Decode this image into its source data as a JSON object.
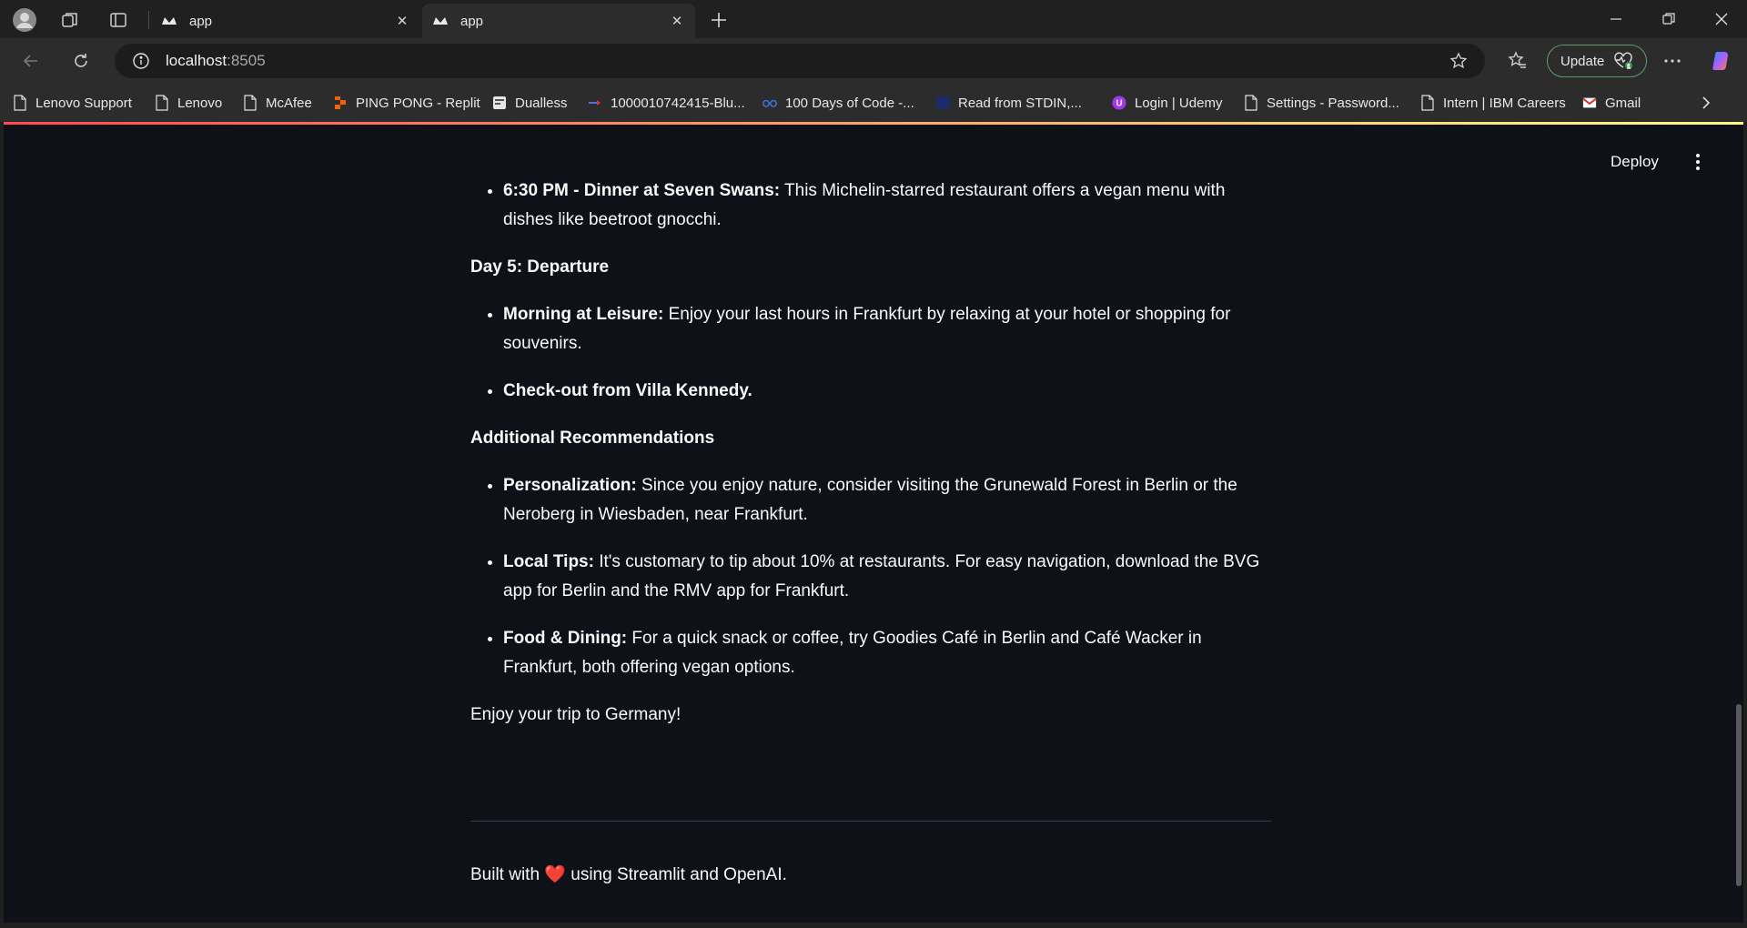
{
  "browser": {
    "tabs": [
      {
        "title": "app",
        "active": false
      },
      {
        "title": "app",
        "active": true
      }
    ],
    "address": {
      "host": "localhost",
      "port": ":8505"
    },
    "update_label": "Update",
    "bookmarks": [
      {
        "label": "Lenovo Support",
        "icon": "page-icon"
      },
      {
        "label": "Lenovo",
        "icon": "page-icon"
      },
      {
        "label": "McAfee",
        "icon": "page-icon"
      },
      {
        "label": "PING PONG - Replit",
        "icon": "replit-icon"
      },
      {
        "label": "Dualless",
        "icon": "dualless-icon"
      },
      {
        "label": "1000010742415-Blu...",
        "icon": "bluedart-icon"
      },
      {
        "label": "100 Days of Code -...",
        "icon": "codedays-icon"
      },
      {
        "label": "Read from STDIN,...",
        "icon": "blue-square-icon"
      },
      {
        "label": "Login | Udemy",
        "icon": "udemy-icon"
      },
      {
        "label": "Settings - Password...",
        "icon": "page-icon"
      },
      {
        "label": "Intern | IBM Careers",
        "icon": "page-icon"
      },
      {
        "label": "Gmail",
        "icon": "gmail-icon"
      }
    ]
  },
  "header": {
    "deploy_label": "Deploy"
  },
  "content": {
    "dinner": {
      "bold": "6:30 PM - Dinner at Seven Swans:",
      "text": " This Michelin-starred restaurant offers a vegan menu with dishes like beetroot gnocchi."
    },
    "day5_heading": "Day 5: Departure",
    "day5_items": [
      {
        "bold": "Morning at Leisure:",
        "text": " Enjoy your last hours in Frankfurt by relaxing at your hotel or shopping for souvenirs."
      },
      {
        "bold": "Check-out from Villa Kennedy.",
        "text": ""
      }
    ],
    "additional_heading": "Additional Recommendations",
    "additional_items": [
      {
        "bold": "Personalization:",
        "text": " Since you enjoy nature, consider visiting the Grunewald Forest in Berlin or the Neroberg in Wiesbaden, near Frankfurt."
      },
      {
        "bold": "Local Tips:",
        "text": " It's customary to tip about 10% at restaurants. For easy navigation, download the BVG app for Berlin and the RMV app for Frankfurt."
      },
      {
        "bold": "Food & Dining:",
        "text": " For a quick snack or coffee, try Goodies Café in Berlin and Café Wacker in Frankfurt, both offering vegan options."
      }
    ],
    "closing": "Enjoy your trip to Germany!"
  },
  "footer": {
    "before": "Built with ",
    "heart": "❤️",
    "after": " using Streamlit and OpenAI."
  },
  "colors": {
    "page_bg": "#0e1117",
    "chrome_bg": "#2c2c2c",
    "accent_gradient_start": "#ff4b4b",
    "accent_gradient_end": "#fffd80"
  }
}
